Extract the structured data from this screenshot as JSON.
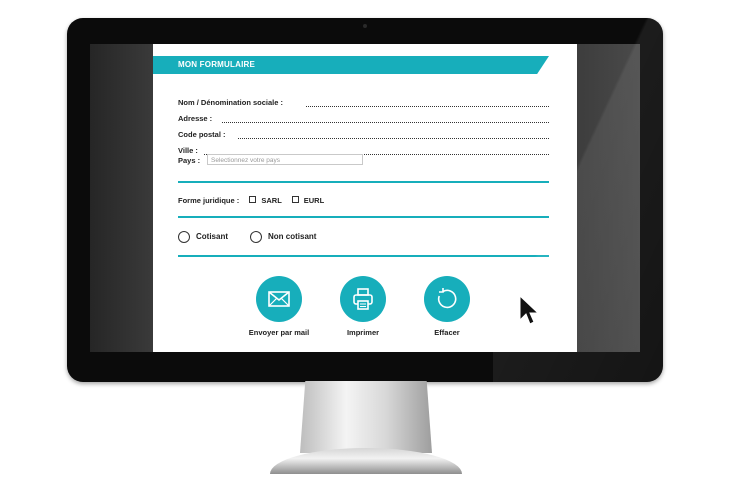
{
  "form": {
    "title": "MON FORMULAIRE",
    "fields": [
      {
        "label": "Nom / Dénomination sociale :"
      },
      {
        "label": "Adresse :"
      },
      {
        "label": "Code postal :"
      },
      {
        "label": "Ville :"
      }
    ],
    "country": {
      "label": "Pays :",
      "placeholder": "Selectionnez votre pays"
    },
    "legal": {
      "label": "Forme juridique :",
      "options": [
        "SARL",
        "EURL"
      ]
    },
    "membership": {
      "options": [
        "Cotisant",
        "Non cotisant"
      ]
    },
    "actions": [
      {
        "label": "Envoyer par mail",
        "icon": "mail-icon"
      },
      {
        "label": "Imprimer",
        "icon": "printer-icon"
      },
      {
        "label": "Effacer",
        "icon": "reset-icon"
      }
    ]
  },
  "colors": {
    "accent": "#17aebb",
    "bezel": "#0b0b0b"
  }
}
